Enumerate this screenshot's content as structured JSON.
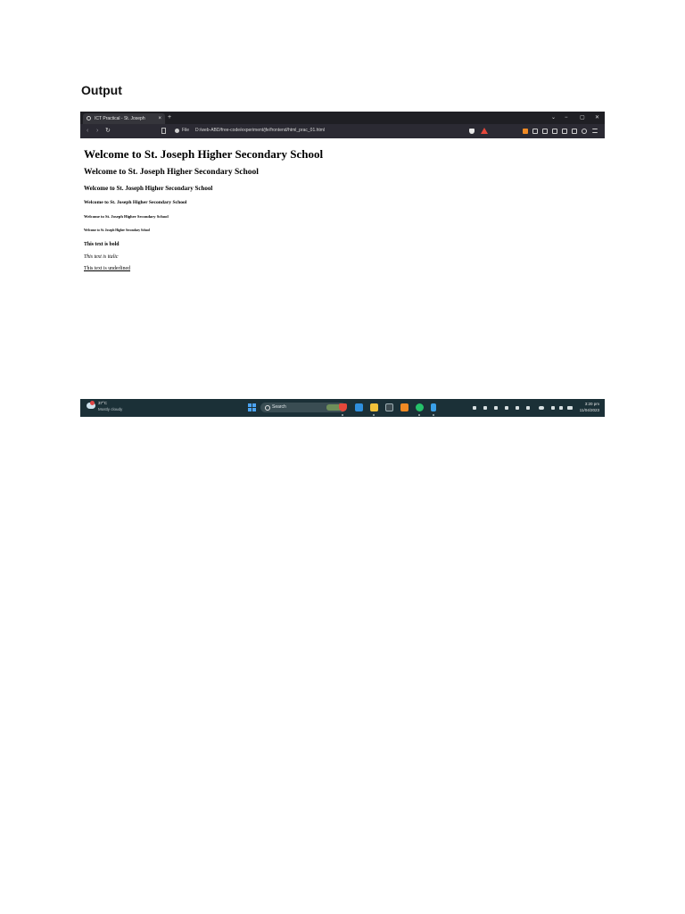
{
  "document": {
    "heading": "Output"
  },
  "browser": {
    "tab_title": "ICT Practical - St. Joseph",
    "tab_close": "×",
    "new_tab": "+",
    "window_controls": {
      "dropdown": "⌄",
      "minimize": "−",
      "maximize": "▢",
      "close": "✕"
    },
    "nav": {
      "back": "‹",
      "forward": "›",
      "reload": "↻"
    },
    "address": {
      "scheme_label": "File",
      "url": "D:/web-ABD/free-code/experiment/jfe/frontend/html_prac_01.html"
    },
    "accent_color": "#e5483b"
  },
  "page": {
    "h1": "Welcome to St. Joseph Higher Secondary School",
    "h2": "Welcome to St. Joseph Higher Secondary School",
    "h3": "Welcome to St. Joseph Higher Secondary School",
    "h4": "Welcome to St. Joseph Higher Secondary School",
    "h5": "Welcome to St. Joseph Higher Secondary School",
    "h6": "Welcome to St. Joseph Higher Secondary School",
    "bold_text": "This text is bold",
    "italic_text": "This text is italic",
    "underline_text": "This text is underlined"
  },
  "taskbar": {
    "weather_temp": "37°C",
    "weather_desc": "Mostly cloudy",
    "search_label": "Search",
    "clock_time": "3:20 pm",
    "clock_date": "11/04/2023",
    "background_color": "#1b3037"
  }
}
